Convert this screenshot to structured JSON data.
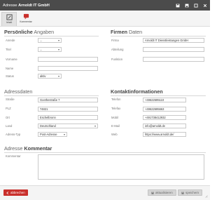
{
  "titlebar": {
    "prefix": "Adresse",
    "name": "Arnoldt IT GmbH"
  },
  "toolbar": {
    "tabs": [
      {
        "label": "Inhalt"
      },
      {
        "label": "Kommentar"
      }
    ]
  },
  "persoenlich": {
    "title_bold": "Persönliche",
    "title_rest": "Angaben",
    "fields": {
      "anrede": {
        "label": "Anrede",
        "value": "..."
      },
      "titel": {
        "label": "Titel",
        "value": "..."
      },
      "vorname": {
        "label": "Vorname",
        "value": ""
      },
      "name": {
        "label": "Name",
        "value": ""
      },
      "status": {
        "label": "Status",
        "value": "aktiv"
      }
    }
  },
  "firmen": {
    "title_bold": "Firmen",
    "title_rest": "Daten",
    "fields": {
      "firma": {
        "label": "Firma",
        "value": "Arnoldt IT Dienstleistungen GmbH"
      },
      "abteilung": {
        "label": "Abteilung",
        "value": ""
      },
      "funktion": {
        "label": "Funktion",
        "value": ""
      }
    }
  },
  "adresse": {
    "title": "Adressdaten",
    "fields": {
      "strasse": {
        "label": "Straße",
        "value": "Goethestraße 7"
      },
      "plz": {
        "label": "PLZ",
        "value": "74821"
      },
      "ort": {
        "label": "Ort",
        "value": "Eschelbronn"
      },
      "land": {
        "label": "Land",
        "value": "Deutschland"
      },
      "typ": {
        "label": "Adress-Typ",
        "value": "Post-Adresse"
      }
    }
  },
  "kontakt": {
    "title": "Kontaktinformationen",
    "fields": {
      "telefon": {
        "label": "Telefon",
        "value": "+49622695110"
      },
      "telefax": {
        "label": "Telefax",
        "value": "+49622695663"
      },
      "mobil": {
        "label": "Mobil",
        "value": "+491738412932"
      },
      "email": {
        "label": "E-Mail",
        "value": "info@arnoldt.de"
      },
      "web": {
        "label": "Web",
        "value": "https://www.arnoldt.de/"
      }
    }
  },
  "kommentar": {
    "title_rest": "Adresse",
    "title_bold": "Kommentar",
    "label": "Kommentar",
    "value": ""
  },
  "footer": {
    "cancel": "abbrechen",
    "refresh": "aktualisieren",
    "save": "speichern"
  },
  "colors": {
    "titlebar": "#4b4b4b",
    "danger": "#c9302c",
    "disabled": "#d5d5d5"
  }
}
